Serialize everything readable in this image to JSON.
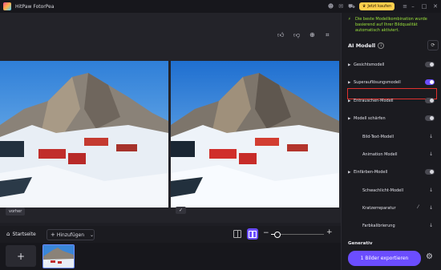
{
  "app": {
    "title": "HitPaw FotorPea"
  },
  "titlebar": {
    "buy_label": "Jetzt kaufen",
    "icons": [
      "discord-icon",
      "mail-icon",
      "cart-icon",
      "menu-icon"
    ],
    "window_controls": [
      "minimize-icon",
      "maximize-icon",
      "close-icon"
    ]
  },
  "canvas": {
    "tools": [
      "thumbs-up-icon",
      "thumbs-down-icon",
      "zoom-in-icon",
      "crop-icon"
    ],
    "label_before": "vorher",
    "label_after_icon": "✓"
  },
  "bottombar": {
    "home_label": "Startseite",
    "add_label": "Hinzufügen",
    "zoom_value": 10
  },
  "panel": {
    "banner": "Die beste Modellkombination wurde basierend auf Ihrer Bildqualität automatisch aktiviert.",
    "ai_title": "AI Modell",
    "models": [
      {
        "label": "Gesichtsmodell",
        "control": "toggle",
        "on": false,
        "caret": true
      },
      {
        "label": "Superauflösungsmodell",
        "control": "toggle",
        "on": true,
        "caret": true
      },
      {
        "label": "Entrauschen-Modell",
        "control": "toggle",
        "on": false,
        "caret": true
      },
      {
        "label": "Modell schärfen",
        "control": "toggle",
        "on": false,
        "caret": true
      },
      {
        "label": "Bild-Text-Modell",
        "control": "download",
        "caret": false
      },
      {
        "label": "Animation Modell",
        "control": "download",
        "caret": false
      },
      {
        "label": "Einfärben-Modell",
        "control": "toggle",
        "on": false,
        "caret": true
      },
      {
        "label": "Schwachlicht-Modell",
        "control": "download",
        "caret": false
      },
      {
        "label": "Kratzerreparatur",
        "control": "download",
        "caret": false
      },
      {
        "label": "Farbkalibrierung",
        "control": "download",
        "caret": false
      }
    ],
    "section_generative": "Generativ",
    "export_label": "1 Bilder exportieren"
  },
  "colors": {
    "accent": "#6b4dff",
    "highlight": "#e0312e",
    "banner_text": "#9be33c",
    "buy_button": "#ffcf4d"
  }
}
